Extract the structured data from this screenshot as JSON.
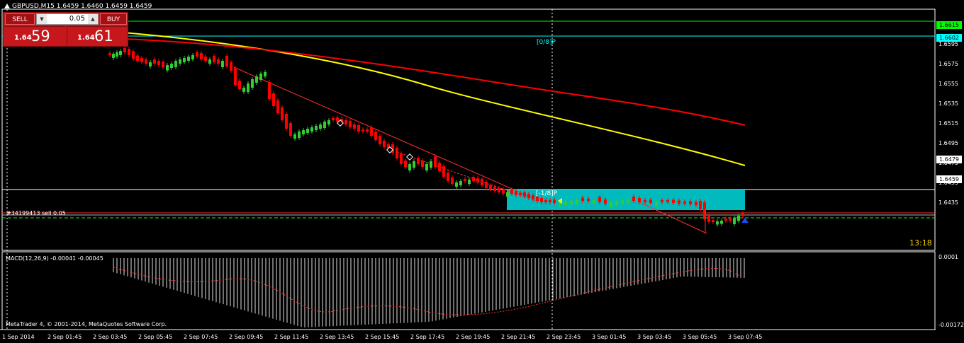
{
  "window": {
    "title": "GBPUSD,M15  1.6459 1.6460 1.6459 1.6459"
  },
  "trade_panel": {
    "sell_label": "SELL",
    "buy_label": "BUY",
    "lot_value": "0.05",
    "sell_price_small": "1.64",
    "sell_price_big": "59",
    "buy_price_small": "1.64",
    "buy_price_big": "61"
  },
  "levels": {
    "top_label": "[0/8]P",
    "lower_label": "[-1/8]P"
  },
  "order": {
    "label": "#34199413 sell 0.05"
  },
  "timer": "13:18",
  "price_tags": [
    {
      "value": "1.6615",
      "color": "#00ff00",
      "level": 1.6615
    },
    {
      "value": "1.6602",
      "color": "#00ffff",
      "level": 1.6602
    },
    {
      "value": "1.6479",
      "color": "#ffffff",
      "level": 1.6479
    },
    {
      "value": "1.6459",
      "color": "#ffffff",
      "level": 1.6459
    }
  ],
  "y_axis": {
    "ticks": [
      "1.6595",
      "1.6575",
      "1.6555",
      "1.6535",
      "1.6515",
      "1.6495",
      "1.6475",
      "1.6455",
      "1.6435"
    ],
    "tick_values": [
      1.6595,
      1.6575,
      1.6555,
      1.6535,
      1.6515,
      1.6495,
      1.6475,
      1.6455,
      1.6435
    ]
  },
  "macd": {
    "label": "MACD(12,26,9) -0.00041 -0.00045",
    "ticks": [
      "0.0001",
      "-0.00172"
    ]
  },
  "x_axis": {
    "ticks": [
      "1 Sep 2014",
      "2 Sep 01:45",
      "2 Sep 03:45",
      "2 Sep 05:45",
      "2 Sep 07:45",
      "2 Sep 09:45",
      "2 Sep 11:45",
      "2 Sep 13:45",
      "2 Sep 15:45",
      "2 Sep 17:45",
      "2 Sep 19:45",
      "2 Sep 21:45",
      "2 Sep 23:45",
      "3 Sep 01:45",
      "3 Sep 03:45",
      "3 Sep 05:45",
      "3 Sep 07:45"
    ]
  },
  "footer": {
    "copyright": "MetaTrader 4, © 2001-2014, MetaQuotes Software Corp."
  },
  "colors": {
    "bull": "#32cd32",
    "bear": "#ff0000",
    "ma_fast": "#ffff00",
    "ma_slow": "#ff0000",
    "box": "#00ced1",
    "green_level": "#00ff00",
    "cyan_level": "#00ffff"
  }
}
